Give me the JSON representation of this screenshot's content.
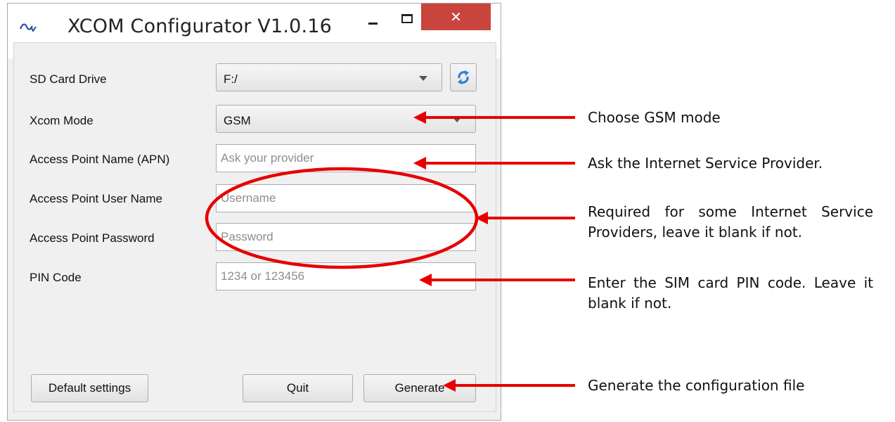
{
  "window": {
    "title": "XCOM Configurator V1.0.16",
    "close_glyph": "✕"
  },
  "form": {
    "sd_card_drive": {
      "label": "SD Card Drive",
      "value": "F:/"
    },
    "xcom_mode": {
      "label": "Xcom Mode",
      "value": "GSM"
    },
    "apn": {
      "label": "Access Point Name (APN)",
      "placeholder": "Ask your provider"
    },
    "ap_user": {
      "label": "Access Point User Name",
      "placeholder": "Username"
    },
    "ap_password": {
      "label": "Access Point Password",
      "placeholder": "Password"
    },
    "pin": {
      "label": "PIN Code",
      "placeholder": "1234 or 123456"
    }
  },
  "buttons": {
    "default_settings": "Default settings",
    "quit": "Quit",
    "generate": "Generate"
  },
  "annotations": {
    "gsm": "Choose GSM mode",
    "apn": "Ask the Internet Service Provider.",
    "credentials": "Required for some Internet Service Providers, leave it blank if not.",
    "pin": "Enter the SIM card PIN code. Leave it blank if not.",
    "generate": "Generate the configuration file"
  },
  "colors": {
    "annotation_red": "#e60000",
    "close_button": "#c8453d"
  },
  "icons": {
    "app": "xcom-logo-icon",
    "refresh": "refresh-icon",
    "dropdown": "chevron-down-icon"
  }
}
